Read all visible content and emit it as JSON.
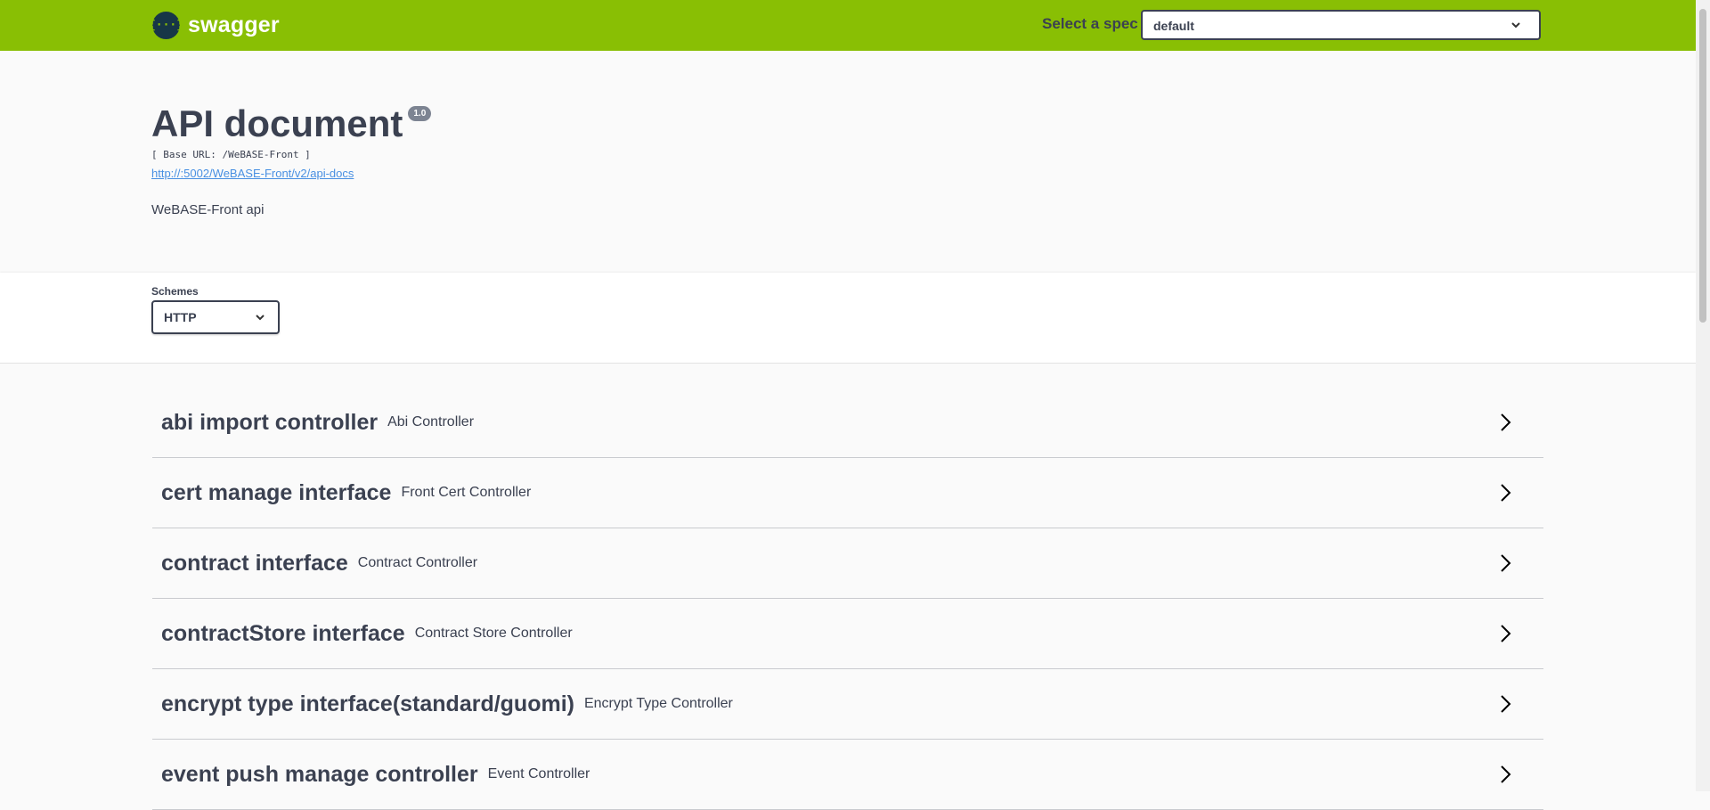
{
  "header": {
    "brand": "swagger",
    "logo_glyph": "{···}",
    "spec_label": "Select a spec",
    "spec_value": "default"
  },
  "info": {
    "title": "API document",
    "version": "1.0",
    "base_url": "[ Base URL: /WeBASE-Front ]",
    "docs_link": "http://:5002/WeBASE-Front/v2/api-docs",
    "description": "WeBASE-Front api"
  },
  "schemes": {
    "label": "Schemes",
    "value": "HTTP"
  },
  "tags": [
    {
      "name": "abi import controller",
      "desc": "Abi Controller"
    },
    {
      "name": "cert manage interface",
      "desc": "Front Cert Controller"
    },
    {
      "name": "contract interface",
      "desc": "Contract Controller"
    },
    {
      "name": "contractStore interface",
      "desc": "Contract Store Controller"
    },
    {
      "name": "encrypt type interface(standard/guomi)",
      "desc": "Encrypt Type Controller"
    },
    {
      "name": "event push manage controller",
      "desc": "Event Controller"
    }
  ],
  "colors": {
    "topbar": "#89bf04",
    "text": "#3b4151",
    "link": "#4990e2"
  }
}
